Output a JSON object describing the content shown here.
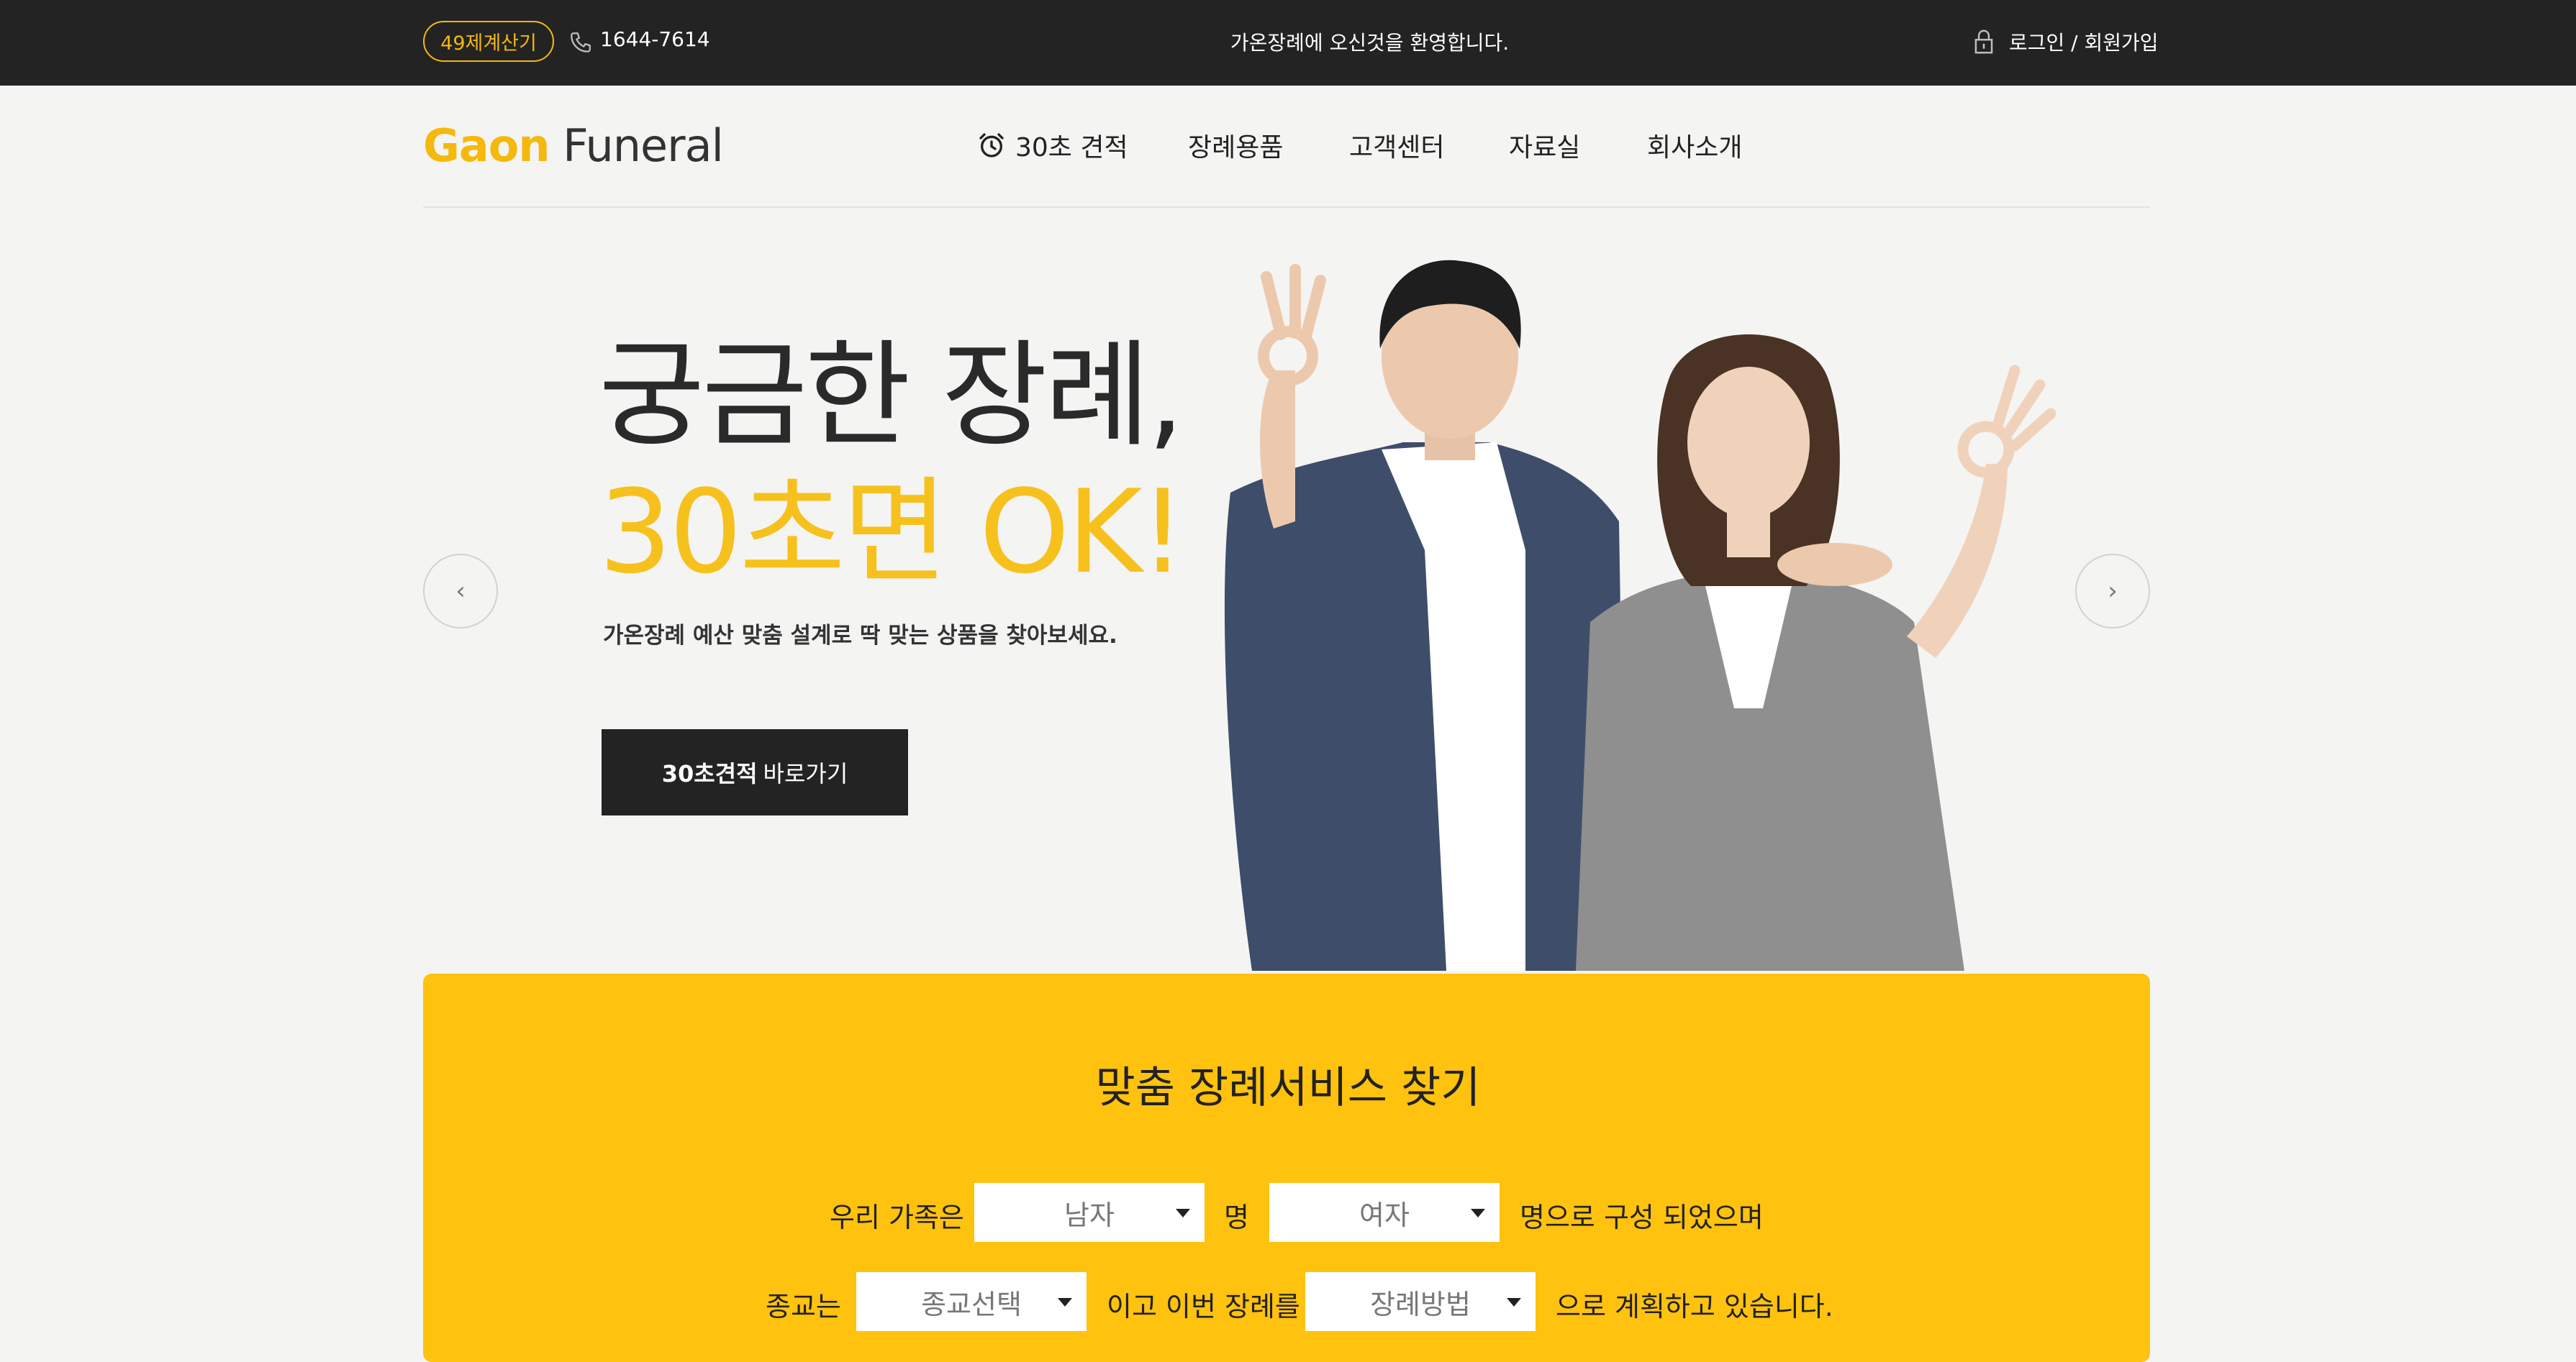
{
  "topbar": {
    "badge": "49제계산기",
    "phone": "1644-7614",
    "welcome": "가온장례에 오신것을 환영합니다.",
    "login": "로그인 / 회원가입"
  },
  "header": {
    "logo_accent": "Gaon",
    "logo_rest": " Funeral",
    "nav": [
      "30초 견적",
      "장례용품",
      "고객센터",
      "자료실",
      "회사소개"
    ]
  },
  "hero": {
    "line1": "궁금한 장례,",
    "line2": "30초면 OK!",
    "subtitle": "가온장례 예산 맞춤 설계로 딱 맞는 상품을 찾아보세요.",
    "cta_bold": "30초견적",
    "cta_rest": "바로가기",
    "prev": "‹",
    "next": "›"
  },
  "finder": {
    "title": "맞춤 장례서비스 찾기",
    "row1_prefix": "우리 가족은",
    "male_value": "남자",
    "row1_middle": "명",
    "female_value": "여자",
    "row1_suffix": "명으로 구성 되었으며",
    "row2_prefix": "종교는",
    "religion_value": "종교선택",
    "row2_middle": "이고 이번 장례를",
    "method_value": "장례방법",
    "row2_suffix": "으로 계획하고 있습니다."
  },
  "colors": {
    "accent": "#f7c11d",
    "finder_bg": "#ffc20e",
    "topbar_bg": "#232323",
    "page_bg": "#f4f4f3"
  },
  "icons": [
    "phone-icon",
    "lock-icon",
    "alarm-clock-icon",
    "chevron-left-icon",
    "chevron-right-icon",
    "caret-down-icon"
  ]
}
